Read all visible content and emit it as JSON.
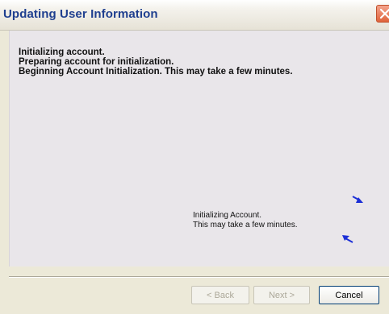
{
  "window": {
    "title": "Updating User Information"
  },
  "messages": [
    "Initializing account.",
    "Preparing account for initialization.",
    "Beginning Account Initialization. This may take a few minutes."
  ],
  "status": {
    "line1": "Initializing Account.",
    "line2": "This may take a few minutes."
  },
  "buttons": {
    "back": "< Back",
    "next": "Next >",
    "cancel": "Cancel"
  },
  "icons": {
    "close": "close-icon",
    "spinner_arrow_top": "arrow-icon",
    "spinner_arrow_bottom": "arrow-icon"
  },
  "colors": {
    "title_text": "#1f3f8f",
    "arrow": "#1c2fd6",
    "close_button": "#e0633b"
  }
}
